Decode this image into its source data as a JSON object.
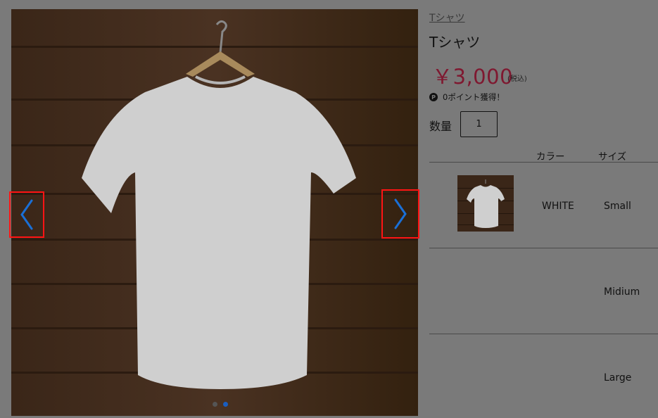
{
  "gallery": {
    "image_alt": "white t-shirt on hanger against dark wooden planks",
    "prev_icon": "chevron-left-icon",
    "next_icon": "chevron-right-icon",
    "accent_color": "#1a6fd6",
    "highlight_color": "#ff1414",
    "dot_count": 2,
    "active_dot": 2
  },
  "product": {
    "breadcrumb": "Tシャツ",
    "title": "Tシャツ",
    "price": "￥3,000",
    "tax_note": "(税込)",
    "points_icon": "P",
    "points_text": "0ポイント獲得！",
    "quantity_label": "数量",
    "quantity_value": "1",
    "price_color": "#7f1830"
  },
  "variants": {
    "headers": {
      "color": "カラー",
      "size": "サイズ"
    },
    "rows": [
      {
        "color": "WHITE",
        "size": "Small"
      },
      {
        "color": "",
        "size": "Midium"
      },
      {
        "color": "",
        "size": "Large"
      }
    ]
  }
}
